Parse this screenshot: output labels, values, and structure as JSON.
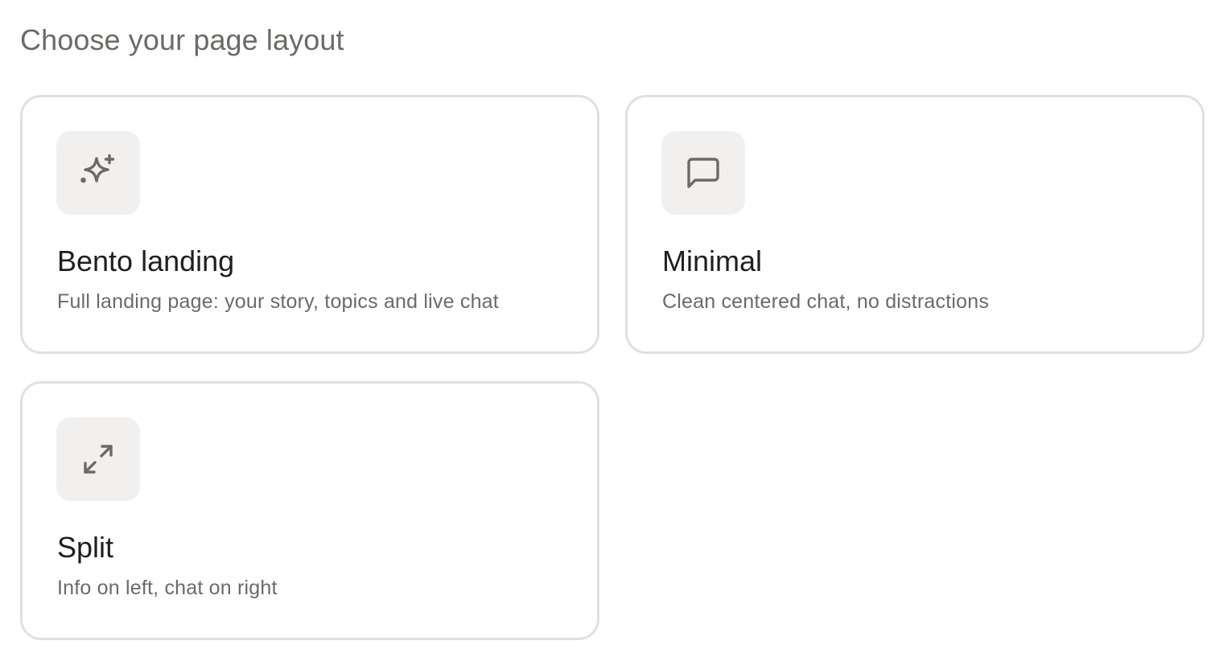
{
  "header": {
    "title": "Choose your page layout"
  },
  "layouts": [
    {
      "icon": "sparkles-icon",
      "title": "Bento landing",
      "description": "Full landing page: your story, topics and live chat"
    },
    {
      "icon": "chat-bubble-icon",
      "title": "Minimal",
      "description": "Clean centered chat, no distractions"
    },
    {
      "icon": "expand-arrows-icon",
      "title": "Split",
      "description": "Info on left, chat on right"
    }
  ],
  "colors": {
    "card_border": "#e2e0dc",
    "icon_tile_bg": "#f1f0ee",
    "icon_stroke": "#6b6a66",
    "title_text": "#1f1f1e",
    "muted_text": "#6b6a66"
  }
}
